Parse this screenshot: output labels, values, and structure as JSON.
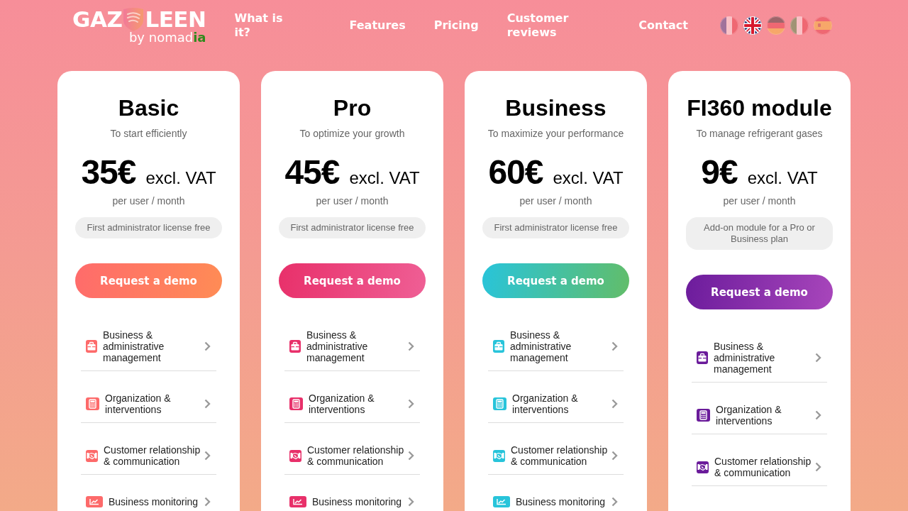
{
  "logo": {
    "name_start": "GAZ",
    "name_end": "LEEN",
    "byline": "by nomad",
    "byline_accent": "ia"
  },
  "nav": {
    "links": [
      "What is it?",
      "Features",
      "Pricing",
      "Customer reviews"
    ],
    "contact": "Contact",
    "languages": [
      {
        "kind": "french",
        "selected": false
      },
      {
        "kind": "british",
        "selected": true
      },
      {
        "kind": "german",
        "selected": false
      },
      {
        "kind": "italian",
        "selected": false
      },
      {
        "kind": "spanish",
        "selected": false
      }
    ]
  },
  "plans": [
    {
      "title": "Basic",
      "subtitle": "To start efficiently",
      "price": "35€",
      "tax": "excl. VAT",
      "period": "per user / month",
      "note": "First administrator license free",
      "color": "#fd6a6a",
      "button": {
        "label": "Request a demo",
        "stops": [
          {
            "color": "#ff6b6b"
          },
          {
            "color": "#ff8c55"
          }
        ]
      },
      "features": [
        {
          "kind": "management",
          "label": "Business & administrative management"
        },
        {
          "kind": "organization",
          "label": "Organization & interventions"
        },
        {
          "kind": "relationship",
          "label": "Customer relationship & communication"
        },
        {
          "kind": "monitoring",
          "label": "Business monitoring"
        }
      ]
    },
    {
      "title": "Pro",
      "subtitle": "To optimize your growth",
      "price": "45€",
      "tax": "excl. VAT",
      "period": "per user / month",
      "note": "First administrator license free",
      "color": "#e8306a",
      "button": {
        "label": "Request a demo",
        "stops": [
          {
            "color": "#e8306a"
          },
          {
            "color": "#ef5f95"
          }
        ]
      },
      "features": [
        {
          "kind": "management",
          "label": "Business & administrative management"
        },
        {
          "kind": "organization",
          "label": "Organization & interventions"
        },
        {
          "kind": "relationship",
          "label": "Customer relationship & communication"
        },
        {
          "kind": "monitoring",
          "label": "Business monitoring"
        }
      ]
    },
    {
      "title": "Business",
      "subtitle": "To maximize your performance",
      "price": "60€",
      "tax": "excl. VAT",
      "period": "per user / month",
      "note": "First administrator license free",
      "color": "#28c4da",
      "button": {
        "label": "Request a demo",
        "stops": [
          {
            "color": "#28c4da"
          },
          {
            "color": "#62bd69"
          }
        ]
      },
      "features": [
        {
          "kind": "management",
          "label": "Business & administrative management"
        },
        {
          "kind": "organization",
          "label": "Organization & interventions"
        },
        {
          "kind": "relationship",
          "label": "Customer relationship & communication"
        },
        {
          "kind": "monitoring",
          "label": "Business monitoring"
        }
      ]
    },
    {
      "title": "FI360 module",
      "subtitle": "To manage refrigerant gases",
      "price": "9€",
      "tax": "excl. VAT",
      "period": "per user / month",
      "note": "Add-on module for a Pro or Business plan",
      "color": "#6a1b9a",
      "button": {
        "label": "Request a demo",
        "stops": [
          {
            "color": "#6c1c9c"
          },
          {
            "color": "#a846bb"
          }
        ]
      },
      "features": [
        {
          "kind": "management",
          "label": "Business & administrative management"
        },
        {
          "kind": "organization",
          "label": "Organization & interventions"
        },
        {
          "kind": "relationship",
          "label": "Customer relationship & communication"
        }
      ]
    }
  ]
}
